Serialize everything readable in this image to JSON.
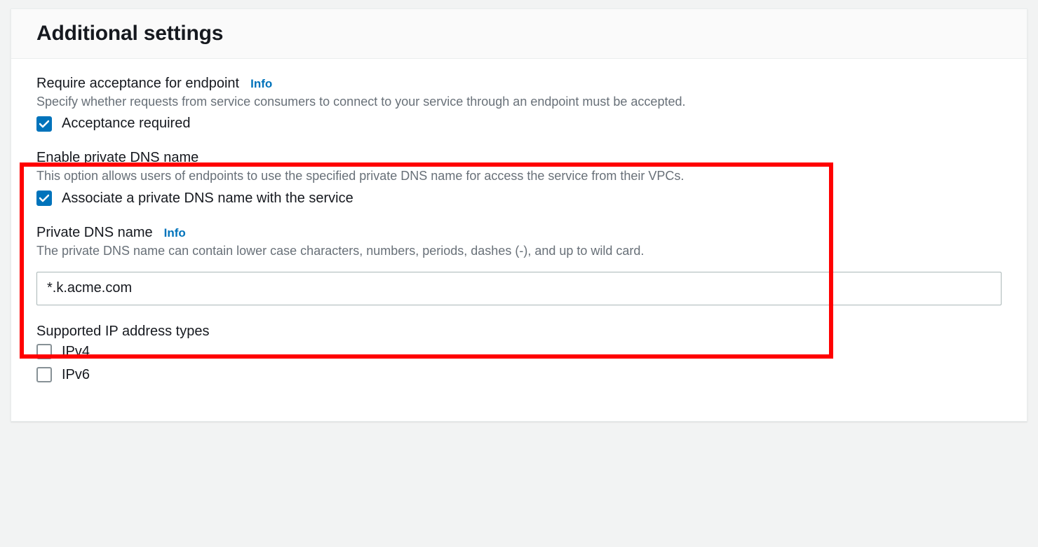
{
  "header": {
    "title": "Additional settings"
  },
  "acceptance": {
    "label": "Require acceptance for endpoint",
    "info": "Info",
    "desc": "Specify whether requests from service consumers to connect to your service through an endpoint must be accepted.",
    "checkbox_label": "Acceptance required",
    "checked": true
  },
  "private_dns": {
    "enable_label": "Enable private DNS name",
    "enable_desc": "This option allows users of endpoints to use the specified private DNS name for access the service from their VPCs.",
    "checkbox_label": "Associate a private DNS name with the service",
    "checked": true,
    "name_label": "Private DNS name",
    "name_info": "Info",
    "name_desc": "The private DNS name can contain lower case characters, numbers, periods, dashes (-), and up to wild card.",
    "value": "*.k.acme.com"
  },
  "ip_types": {
    "label": "Supported IP address types",
    "options": [
      {
        "label": "IPv4",
        "checked": false
      },
      {
        "label": "IPv6",
        "checked": false
      }
    ]
  }
}
